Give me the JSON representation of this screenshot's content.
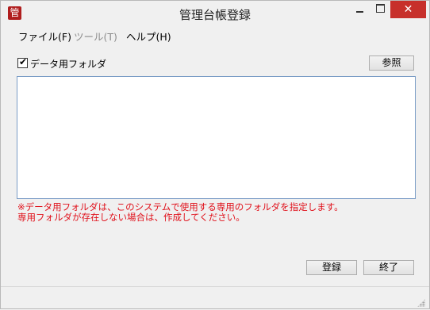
{
  "window": {
    "title": "管理台帳登録",
    "icon_glyph": "管",
    "controls": {
      "minimize": "minimize-icon",
      "maximize": "maximize-icon",
      "close": "✕"
    }
  },
  "menu": [
    {
      "label": "ファイル(F)",
      "enabled": true
    },
    {
      "label": "ツール(T)",
      "enabled": false
    },
    {
      "label": "ヘルプ(H)",
      "enabled": true
    }
  ],
  "data_folder": {
    "checkbox_label": "データ用フォルダ",
    "checked": true,
    "browse_label": "参照",
    "value": ""
  },
  "notice": {
    "line1": "※データ用フォルダは、このシステムで使用する専用のフォルダを指定します。",
    "line2": "専用フォルダが存在しない場合は、作成してください。",
    "color": "#e0101a"
  },
  "actions": {
    "register_label": "登録",
    "exit_label": "終了"
  }
}
